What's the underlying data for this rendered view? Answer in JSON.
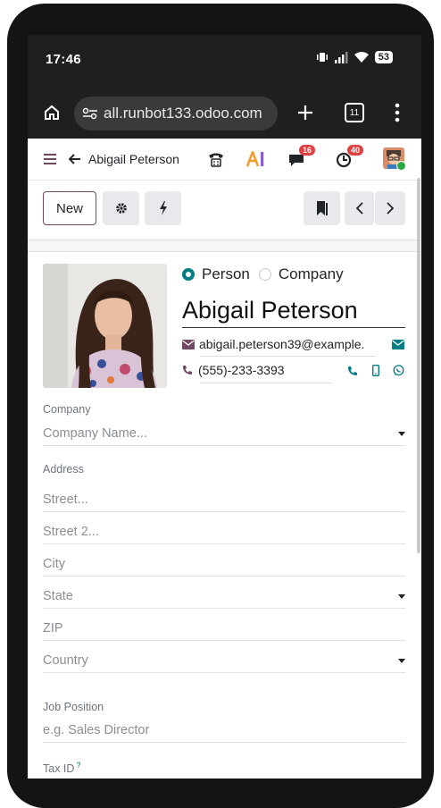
{
  "status": {
    "time": "17:46",
    "battery": "53"
  },
  "browser": {
    "url": "all.runbot133.odoo.com",
    "tab_count": "11"
  },
  "navbar": {
    "breadcrumb": "Abigail Peterson",
    "messages_count": "16",
    "activities_count": "40"
  },
  "toolbar": {
    "new_label": "New"
  },
  "form": {
    "type_person": "Person",
    "type_company": "Company",
    "name": "Abigail Peterson",
    "email": "abigail.peterson39@example.",
    "phone": "(555)-233-3393",
    "company_label": "Company",
    "company_placeholder": "Company Name...",
    "address_label": "Address",
    "street_placeholder": "Street...",
    "street2_placeholder": "Street 2...",
    "city_placeholder": "City",
    "state_placeholder": "State",
    "zip_placeholder": "ZIP",
    "country_placeholder": "Country",
    "job_label": "Job Position",
    "job_placeholder": "e.g. Sales Director",
    "tax_label": "Tax ID",
    "tax_help": "?"
  },
  "colors": {
    "accent": "#017e84",
    "brand": "#71485f",
    "badge": "#e04040"
  }
}
